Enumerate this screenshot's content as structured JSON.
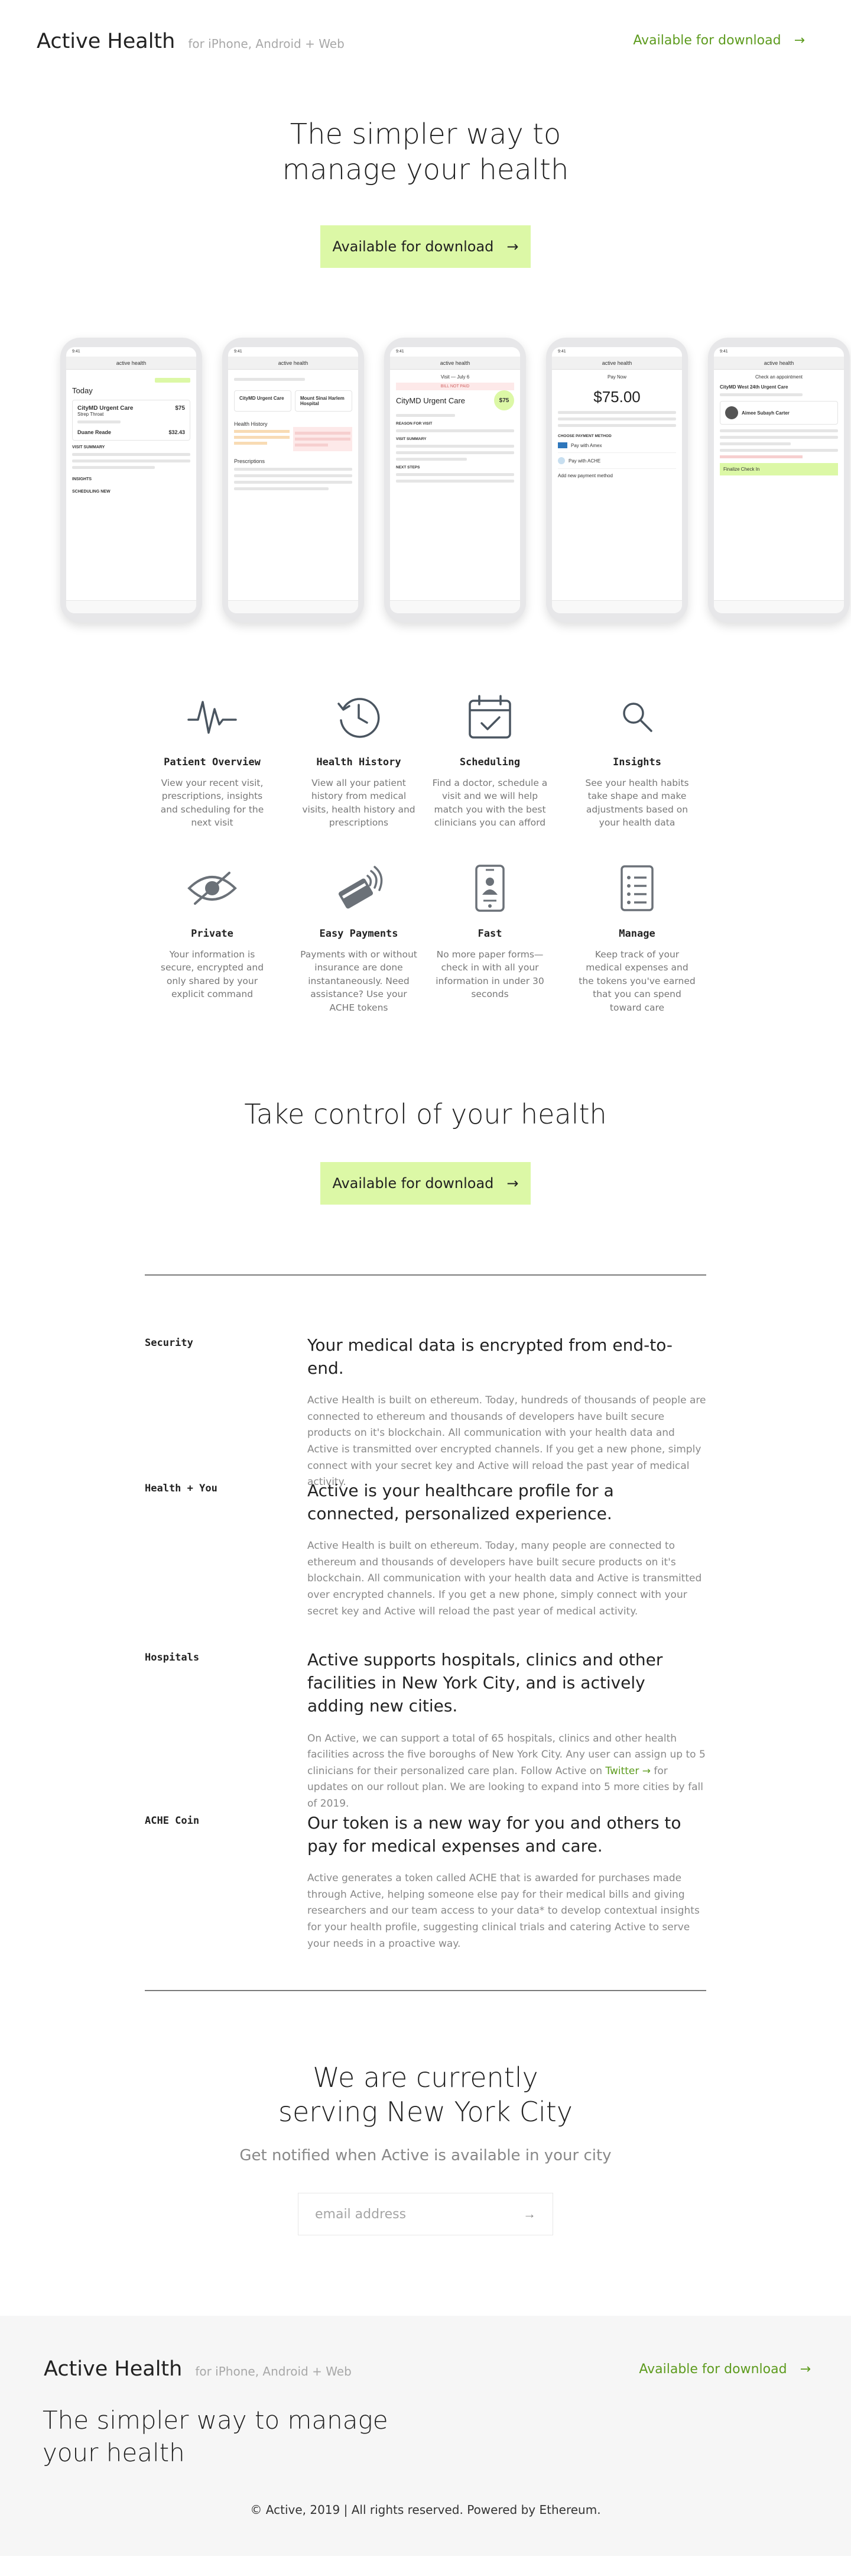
{
  "header": {
    "brand": "Active Health",
    "platforms": "for iPhone, Android + Web",
    "download_label": "Available for download"
  },
  "hero": {
    "title": "The simpler way to manage your health",
    "cta_label": "Available for download"
  },
  "arrow": "→",
  "phones": [
    {
      "url": "active health",
      "today": "Today",
      "visit_title": "CityMD Urgent Care",
      "visit_sub": "Strep Throat",
      "price_a": "$75",
      "provider": "Duane Reade",
      "price_b": "$32.43",
      "section_a": "VISIT SUMMARY",
      "section_b": "INSIGHTS",
      "section_c": "SCHEDULING NEW"
    },
    {
      "url": "active health",
      "card_a": "CityMD Urgent Care",
      "card_b": "Mount Sinai Harlem Hospital",
      "history": "Health History",
      "prescriptions": "Prescriptions"
    },
    {
      "url": "active health",
      "back": "Visit — July 6",
      "bill": "BILL NOT PAID",
      "title": "CityMD Urgent Care",
      "price": "$75",
      "reason": "REASON FOR VISIT",
      "summary": "VISIT SUMMARY",
      "next": "NEXT STEPS"
    },
    {
      "url": "active health",
      "title": "Pay Now",
      "price": "$75.00",
      "method": "CHOOSE PAYMENT METHOD",
      "option_a": "Pay with Amex",
      "option_b": "Pay with ACHE",
      "option_c": "Add new payment method"
    },
    {
      "url": "active health",
      "title": "Check an appointment",
      "visit": "CityMD West 24th Urgent Care",
      "doctor": "Aimee Subayh Carter",
      "button": "Finalize Check In"
    }
  ],
  "features": [
    {
      "icon": "pulse-icon",
      "title": "Patient Overview",
      "desc": "View your recent visit, prescriptions, insights and scheduling for the next visit"
    },
    {
      "icon": "clock-history-icon",
      "title": "Health History",
      "desc": "View all your patient history from medical visits, health history and prescriptions"
    },
    {
      "icon": "calendar-check-icon",
      "title": "Scheduling",
      "desc": "Find a doctor, schedule a visit and we will help match you with the best clinicians you can afford"
    },
    {
      "icon": "magnifier-icon",
      "title": "Insights",
      "desc": "See your health habits take shape and make adjustments based on your health data"
    },
    {
      "icon": "eye-slash-icon",
      "title": "Private",
      "desc": "Your information is secure, encrypted and only shared by your explicit command"
    },
    {
      "icon": "contactless-card-icon",
      "title": "Easy Payments",
      "desc": "Payments with or without insurance are done instantaneously. Need assistance? Use your ACHE tokens"
    },
    {
      "icon": "phone-checkin-icon",
      "title": "Fast",
      "desc": "No more paper forms—check in with all your information in under 30 seconds"
    },
    {
      "icon": "document-list-icon",
      "title": "Manage",
      "desc": "Keep track of your medical expenses and the tokens you've earned that you can spend toward care"
    }
  ],
  "control": {
    "title": "Take control of your health",
    "cta_label": "Available for download"
  },
  "info": [
    {
      "label": "Security",
      "heading": "Your medical data is encrypted from end-to-end.",
      "text": "Active Health is built on ethereum. Today, hundreds of thousands of people are connected to ethereum and thousands of developers have built secure products on it's blockchain. All communication with your health data and Active is transmitted over encrypted channels. If you get a new phone, simply connect with your secret key and Active will reload the past year of medical activity."
    },
    {
      "label": "Health + You",
      "heading": "Active is your healthcare profile for a connected, personalized experience.",
      "text": "Active Health is built on ethereum. Today, many people are connected to ethereum and thousands of developers have built secure products on it's blockchain.  All communication with your health data and Active is transmitted over encrypted channels. If you get a new phone, simply connect with your secret key and Active will reload the past year of medical activity."
    },
    {
      "label": "Hospitals",
      "heading": "Active supports hospitals, clinics and other facilities in New York City, and is actively adding new cities.",
      "text_before": "On Active, we can support a total of 65 hospitals, clinics and other health facilities across the five boroughs of New York City. Any user can assign up to 5 clinicians for their personalized care plan. Follow Active on ",
      "link": "Twitter →",
      "text_after": " for updates on our rollout plan. We are looking to expand into 5 more cities by fall of 2019."
    },
    {
      "label": "ACHE Coin",
      "heading": "Our token is a new way for you and others to pay for medical expenses and care.",
      "text": "Active generates a token called ACHE that is awarded for purchases made through Active, helping someone else pay for their medical bills and giving researchers and our team access to your data* to develop contextual insights for your health profile, suggesting clinical trials and catering Active to serve your needs in a proactive way."
    }
  ],
  "serving": {
    "title": "We are currently serving New York City",
    "subtitle": "Get notified when Active is available in your city",
    "placeholder": "email address",
    "submit": "→"
  },
  "footer": {
    "brand": "Active Health",
    "platforms": "for iPhone, Android + Web",
    "download_label": "Available for download",
    "title": "The simpler way to manage your health",
    "copyright": "© Active, 2019  |  All rights reserved. Powered by Ethereum."
  },
  "colors": {
    "accent_green": "#dcf8a6",
    "link_green": "#5d9b1e",
    "text": "#222222",
    "muted": "#888888"
  }
}
